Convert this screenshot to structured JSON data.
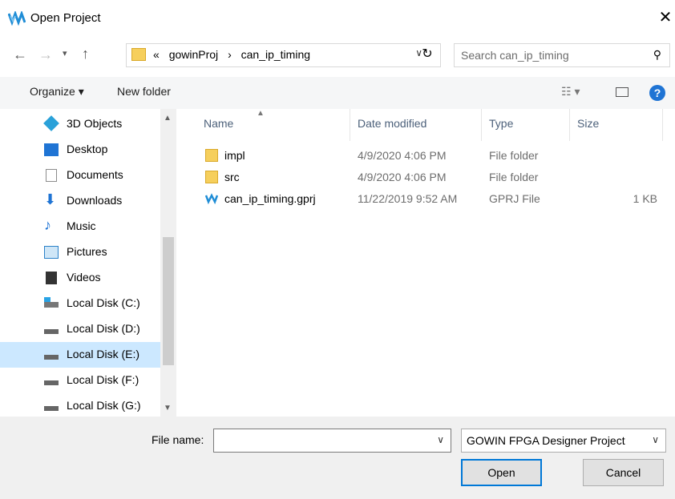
{
  "window": {
    "title": "Open Project"
  },
  "address": {
    "crumbs": [
      "«",
      "gowinProj",
      "›",
      "can_ip_timing"
    ]
  },
  "search": {
    "placeholder": "Search can_ip_timing"
  },
  "toolbar": {
    "organize": "Organize ▾",
    "new_folder": "New folder"
  },
  "sidebar": {
    "items": [
      {
        "label": "3D Objects",
        "icon": "cube-icon",
        "color": "#2aa1d9"
      },
      {
        "label": "Desktop",
        "icon": "desktop-icon",
        "color": "#1f74d4"
      },
      {
        "label": "Documents",
        "icon": "document-icon",
        "color": "#8c8c8c"
      },
      {
        "label": "Downloads",
        "icon": "download-arrow-icon",
        "color": "#1f74d4"
      },
      {
        "label": "Music",
        "icon": "music-note-icon",
        "color": "#1f74d4"
      },
      {
        "label": "Pictures",
        "icon": "picture-icon",
        "color": "#2c82c9"
      },
      {
        "label": "Videos",
        "icon": "video-icon",
        "color": "#333333"
      },
      {
        "label": "Local Disk (C:)",
        "icon": "windows-drive-icon",
        "color": "#555555"
      },
      {
        "label": "Local Disk (D:)",
        "icon": "drive-icon",
        "color": "#555555"
      },
      {
        "label": "Local Disk (E:)",
        "icon": "drive-icon",
        "color": "#555555",
        "selected": true
      },
      {
        "label": "Local Disk (F:)",
        "icon": "drive-icon",
        "color": "#555555"
      },
      {
        "label": "Local Disk (G:)",
        "icon": "drive-icon",
        "color": "#555555"
      }
    ]
  },
  "columns": {
    "name": "Name",
    "date": "Date modified",
    "type": "Type",
    "size": "Size"
  },
  "files": [
    {
      "name": "impl",
      "date": "4/9/2020 4:06 PM",
      "type": "File folder",
      "size": "",
      "icon": "folder-icon"
    },
    {
      "name": "src",
      "date": "4/9/2020 4:06 PM",
      "type": "File folder",
      "size": "",
      "icon": "folder-icon"
    },
    {
      "name": "can_ip_timing.gprj",
      "date": "11/22/2019 9:52 AM",
      "type": "GPRJ File",
      "size": "1 KB",
      "icon": "gowin-logo-icon"
    }
  ],
  "footer": {
    "file_name_label": "File name:",
    "file_name_value": "",
    "file_type": "GOWIN FPGA Designer Project",
    "open_label": "Open",
    "cancel_label": "Cancel"
  },
  "colors": {
    "accent": "#0078d7",
    "selection": "#cce8ff",
    "folder": "#f6cf5c",
    "gowin": "#1f8dd6"
  }
}
